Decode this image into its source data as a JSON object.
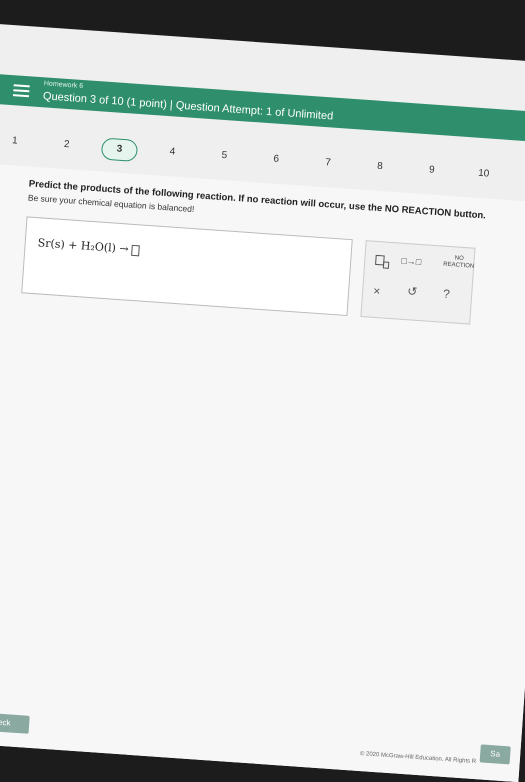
{
  "header": {
    "homework_title": "Homework 6",
    "question_info": "Question 3 of 10 (1 point) | Question Attempt: 1 of Unlimited"
  },
  "question_nav": {
    "items": [
      "1",
      "2",
      "3",
      "4",
      "5",
      "6",
      "7",
      "8",
      "9",
      "10"
    ],
    "current": "3"
  },
  "content": {
    "prompt": "Predict the products of the following reaction. If no reaction will occur, use the NO REACTION button.",
    "note": "Be sure your chemical equation is balanced!",
    "equation": "Sr(s) + H₂O(l) →"
  },
  "tools": {
    "arrow_label": "□→□",
    "no_reaction_label_1": "NO",
    "no_reaction_label_2": "REACTION",
    "clear_label": "×",
    "undo_label": "↺",
    "help_label": "?"
  },
  "footer": {
    "check_label": "Check",
    "save_label": "Sa",
    "copyright": "© 2020 McGraw-Hill Education. All Rights R"
  },
  "colors": {
    "header_green": "#2f8f6d",
    "button_gray_green": "#8aa9a0"
  }
}
